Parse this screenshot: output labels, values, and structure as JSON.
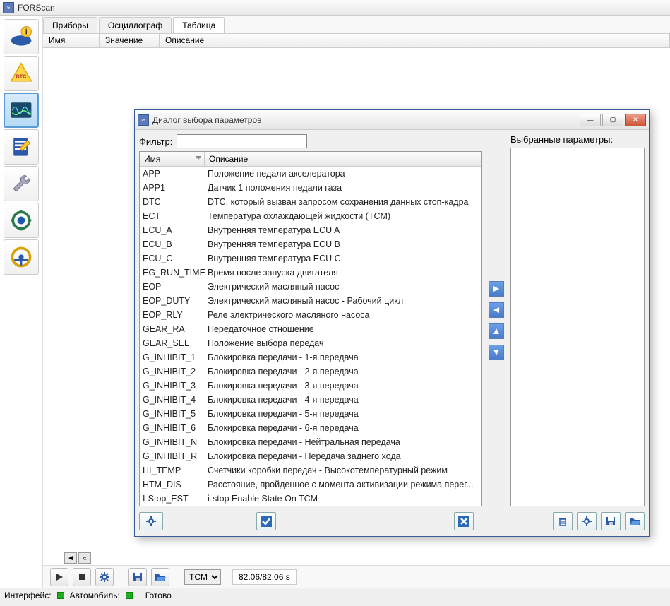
{
  "app": {
    "title": "FORScan"
  },
  "tabs": [
    {
      "label": "Приборы",
      "active": false
    },
    {
      "label": "Осциллограф",
      "active": false
    },
    {
      "label": "Таблица",
      "active": true
    }
  ],
  "columns": {
    "name": "Имя",
    "value": "Значение",
    "desc": "Описание"
  },
  "bottom": {
    "module": "TCM",
    "time": "82.06/82.06 s"
  },
  "status": {
    "interface_label": "Интерфейс:",
    "auto_label": "Автомобиль:",
    "ready": "Готово"
  },
  "dialog": {
    "title": "Диалог выбора параметров",
    "filter_label": "Фильтр:",
    "filter_value": "",
    "col_name": "Имя",
    "col_desc": "Описание",
    "selected_label": "Выбранные параметры:",
    "params": [
      {
        "name": "APP",
        "desc": "Положение педали акселератора"
      },
      {
        "name": "APP1",
        "desc": "Датчик 1 положения педали газа"
      },
      {
        "name": "DTC",
        "desc": "DTC, который вызван запросом сохранения данных стоп-кадра"
      },
      {
        "name": "ECT",
        "desc": "Температура охлаждающей жидкости (TCM)"
      },
      {
        "name": "ECU_A",
        "desc": "Внутренняя температура ECU A"
      },
      {
        "name": "ECU_B",
        "desc": "Внутренняя температура ECU B"
      },
      {
        "name": "ECU_C",
        "desc": "Внутренняя температура ECU C"
      },
      {
        "name": "EG_RUN_TIME",
        "desc": "Время после запуска двигателя"
      },
      {
        "name": "EOP",
        "desc": "Электрический масляный насос"
      },
      {
        "name": "EOP_DUTY",
        "desc": "Электрический масляный насос - Рабочий цикл"
      },
      {
        "name": "EOP_RLY",
        "desc": "Реле электрического масляного насоса"
      },
      {
        "name": "GEAR_RA",
        "desc": "Передаточное отношение"
      },
      {
        "name": "GEAR_SEL",
        "desc": "Положение выбора передач"
      },
      {
        "name": "G_INHIBIT_1",
        "desc": "Блокировка передачи - 1-я передача"
      },
      {
        "name": "G_INHIBIT_2",
        "desc": "Блокировка передачи - 2-я передача"
      },
      {
        "name": "G_INHIBIT_3",
        "desc": "Блокировка передачи - 3-я передача"
      },
      {
        "name": "G_INHIBIT_4",
        "desc": "Блокировка передачи - 4-я передача"
      },
      {
        "name": "G_INHIBIT_5",
        "desc": "Блокировка передачи - 5-я передача"
      },
      {
        "name": "G_INHIBIT_6",
        "desc": "Блокировка передачи - 6-я передача"
      },
      {
        "name": "G_INHIBIT_N",
        "desc": "Блокировка передачи - Нейтральная передача"
      },
      {
        "name": "G_INHIBIT_R",
        "desc": "Блокировка передачи - Передача заднего хода"
      },
      {
        "name": "HI_TEMP",
        "desc": "Счетчики коробки передач - Высокотемпературный режим"
      },
      {
        "name": "HTM_DIS",
        "desc": "Расстояние, пройденное с момента активизации режима перег..."
      },
      {
        "name": "I-Stop_EST",
        "desc": "i-stop Enable State On TCM"
      }
    ]
  }
}
